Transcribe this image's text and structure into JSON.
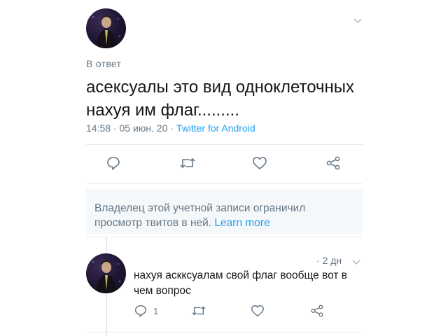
{
  "main_tweet": {
    "reply_to_label": "В ответ",
    "text_line1": "асексуалы это вид одноклеточных",
    "text_line2": "нахуя им флаг.........",
    "time": "14:58",
    "date": "05 июн. 20",
    "client": "Twitter for Android",
    "separator": "·"
  },
  "notice": {
    "line1": "Владелец этой учетной записи ограничил",
    "line2": "просмотр твитов в ней.",
    "learn_more": "Learn more"
  },
  "reply_tweet": {
    "age": "2 дн",
    "separator": "·",
    "text_line1": "нахуя аскксуалам свой флаг вообще вот в",
    "text_line2": "чем вопрос",
    "reply_count": "1"
  },
  "colors": {
    "accent": "#1da1f2",
    "muted": "#657786",
    "icon": "#657786",
    "divider": "#e6ecf0"
  },
  "icons": [
    "chevron-down-icon",
    "reply-icon",
    "retweet-icon",
    "like-icon",
    "share-icon"
  ]
}
